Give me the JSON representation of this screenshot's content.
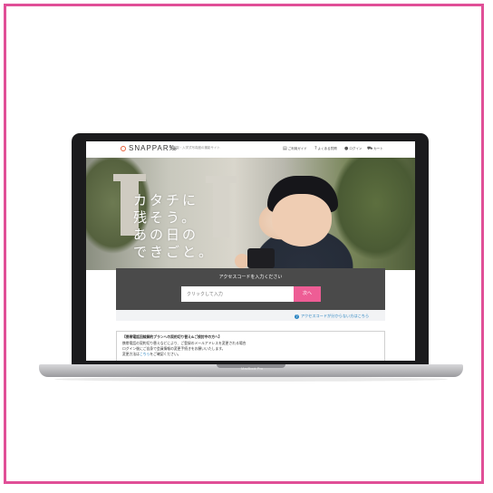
{
  "site": {
    "logo": "SNAPPAR‰",
    "tagline": "卒業園・入学式写真館の撮影サイト"
  },
  "nav": {
    "items": [
      {
        "label": "ご利用ガイド",
        "icon": "book-icon"
      },
      {
        "label": "よくある質問",
        "icon": "question-icon"
      },
      {
        "label": "ログイン",
        "icon": "user-icon"
      },
      {
        "label": "カート",
        "icon": "cart-icon"
      }
    ]
  },
  "hero": {
    "lines": [
      "カタチに",
      "残そう。",
      "あの日の",
      "できごと。"
    ]
  },
  "access": {
    "title": "アクセスコードを入力ください",
    "placeholder": "クリックして入力",
    "submit": "次へ",
    "help_link": "アクセスコードが分からない方はこちら"
  },
  "notice": {
    "heading": "【携帯電話回線解約プランへの契約切り替え&ご検討中の方へ】",
    "line1": "携帯電話の契約切り替えなどにより、ご登録のメールアドレスを変更される場合",
    "line2": "ログイン後にご自身で会員情報の変更手続きをお願いいたします。",
    "line3_prefix": "変更方法は",
    "line3_link": "こちら",
    "line3_suffix": "をご確認ください。"
  },
  "laptop": {
    "model": "MacBook Pro"
  },
  "colors": {
    "frame": "#e04f97",
    "accent": "#ee5d95",
    "link": "#2a84c2",
    "panel": "#4a4a4a"
  }
}
